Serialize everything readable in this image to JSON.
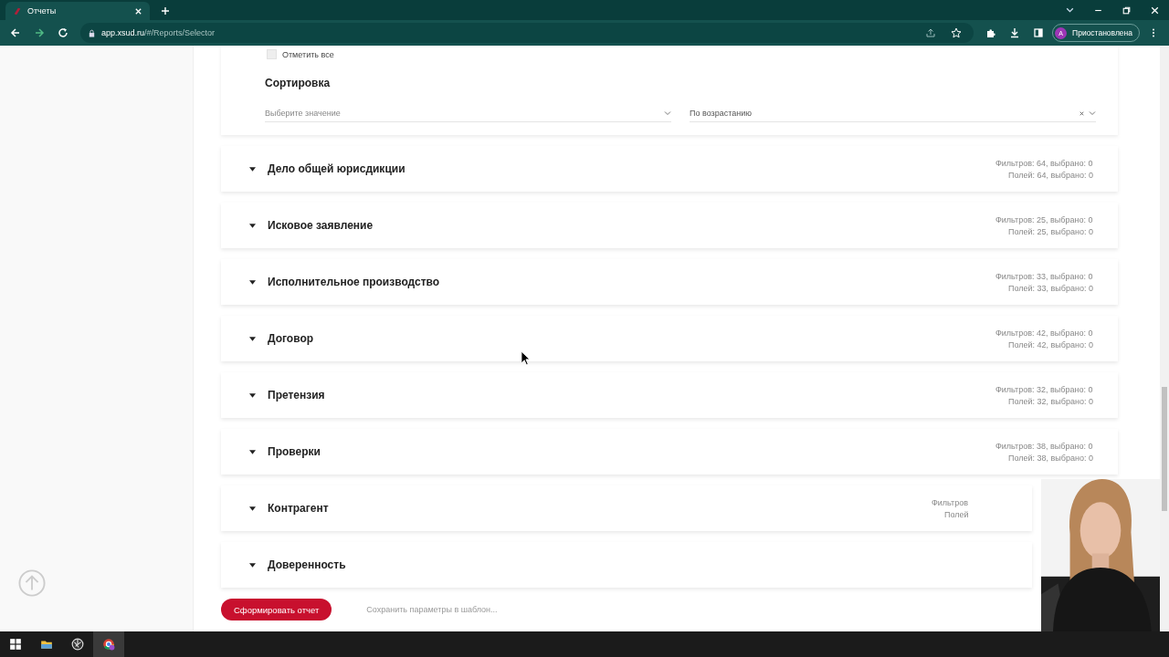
{
  "browser": {
    "tab_title": "Отчеты",
    "url_host": "app.xsud.ru",
    "url_path": "/#/Reports/Selector",
    "profile": {
      "initial": "A",
      "status": "Приостановлена"
    }
  },
  "sort_panel": {
    "select_all": {
      "label": "Отметить все",
      "checked": false
    },
    "title": "Сортировка",
    "field_select": {
      "placeholder": "Выберите значение"
    },
    "order_select": {
      "value": "По возрастанию"
    }
  },
  "sections": [
    {
      "title": "Дело общей юрисдикции",
      "filters": "Фильтров: 64, выбрано: 0",
      "fields": "Полей: 64, выбрано: 0"
    },
    {
      "title": "Исковое заявление",
      "filters": "Фильтров: 25, выбрано: 0",
      "fields": "Полей: 25, выбрано: 0"
    },
    {
      "title": "Исполнительное производство",
      "filters": "Фильтров: 33, выбрано: 0",
      "fields": "Полей: 33, выбрано: 0"
    },
    {
      "title": "Договор",
      "filters": "Фильтров: 42, выбрано: 0",
      "fields": "Полей: 42, выбрано: 0"
    },
    {
      "title": "Претензия",
      "filters": "Фильтров: 32, выбрано: 0",
      "fields": "Полей: 32, выбрано: 0"
    },
    {
      "title": "Проверки",
      "filters": "Фильтров: 38, выбрано: 0",
      "fields": "Полей: 38, выбрано: 0"
    },
    {
      "title": "Контрагент",
      "filters": "Фильтров",
      "fields": "Полей"
    },
    {
      "title": "Доверенность"
    }
  ],
  "actions": {
    "submit": "Сформировать отчет",
    "save_template": "Сохранить параметры в шаблон..."
  }
}
